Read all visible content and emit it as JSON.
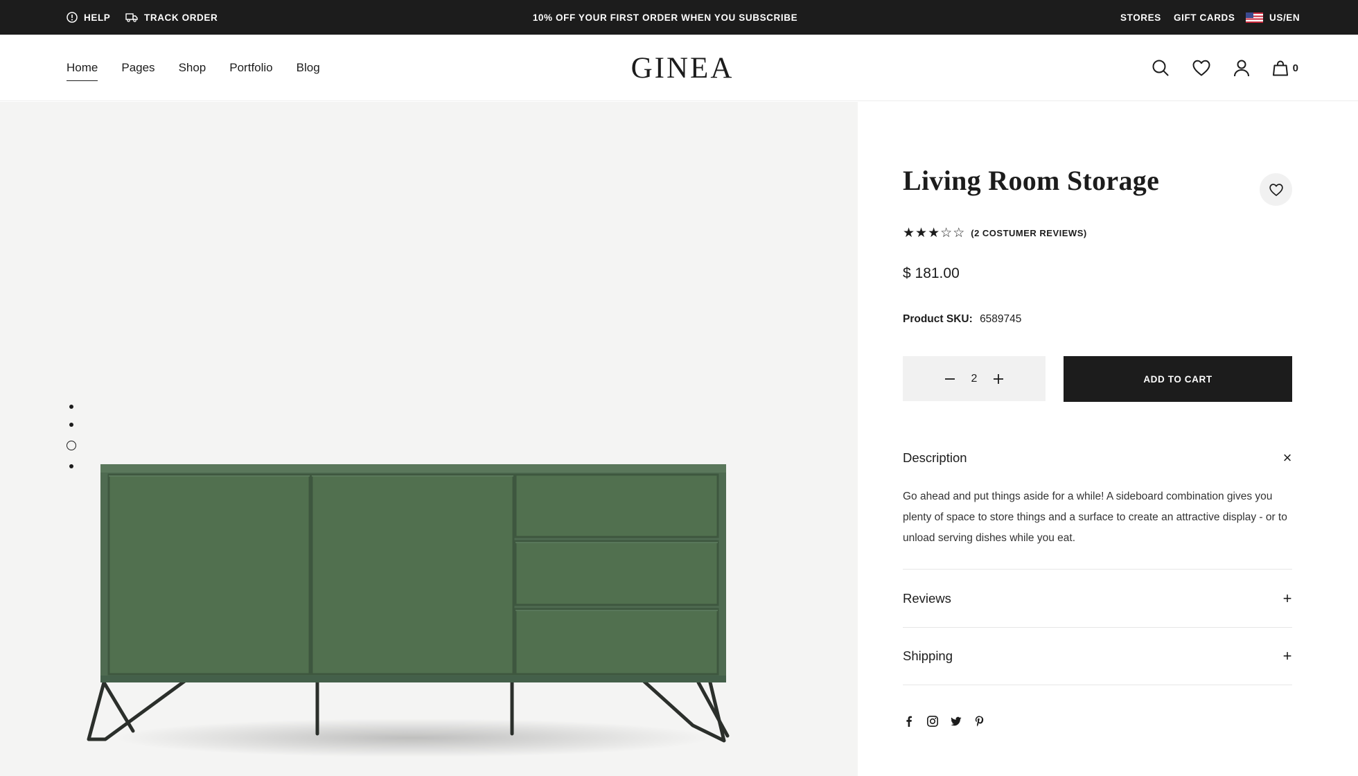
{
  "topbar": {
    "help_label": "HELP",
    "track_label": "TRACK ORDER",
    "promo": "10% OFF YOUR FIRST ORDER WHEN YOU SUBSCRIBE",
    "stores_label": "STORES",
    "gift_cards_label": "GIFT CARDS",
    "lang_label": "US/EN"
  },
  "header": {
    "logo": "GINEA",
    "nav": [
      "Home",
      "Pages",
      "Shop",
      "Portfolio",
      "Blog"
    ],
    "active_nav": "Home",
    "cart_count": "0",
    "icons": [
      "search-icon",
      "heart-icon",
      "user-icon",
      "bag-icon"
    ]
  },
  "gallery": {
    "slides": 4,
    "active_slide": 3,
    "product_color": "#4f6b51"
  },
  "product": {
    "title": "Living Room Storage",
    "rating": 3,
    "rating_max": 5,
    "reviews_label": "(2 COSTUMER REVIEWS)",
    "price": "$ 181.00",
    "sku_label": "Product SKU:",
    "sku_value": "6589745",
    "quantity": "2",
    "add_to_cart_label": "ADD TO CART"
  },
  "accordion": {
    "description_title": "Description",
    "description_sign": "×",
    "description_text": "Go ahead and put things aside for a while! A sideboard combination gives you plenty of space to store things and a surface to create an attractive display - or to unload serving dishes while you eat.",
    "reviews_title": "Reviews",
    "reviews_sign": "+",
    "shipping_title": "Shipping",
    "shipping_sign": "+"
  },
  "social": [
    "facebook-icon",
    "instagram-icon",
    "twitter-icon",
    "pinterest-icon"
  ],
  "colors": {
    "dark": "#1c1c1c",
    "panel_bg": "#f4f4f3",
    "qty_bg": "#f1f1f1"
  }
}
